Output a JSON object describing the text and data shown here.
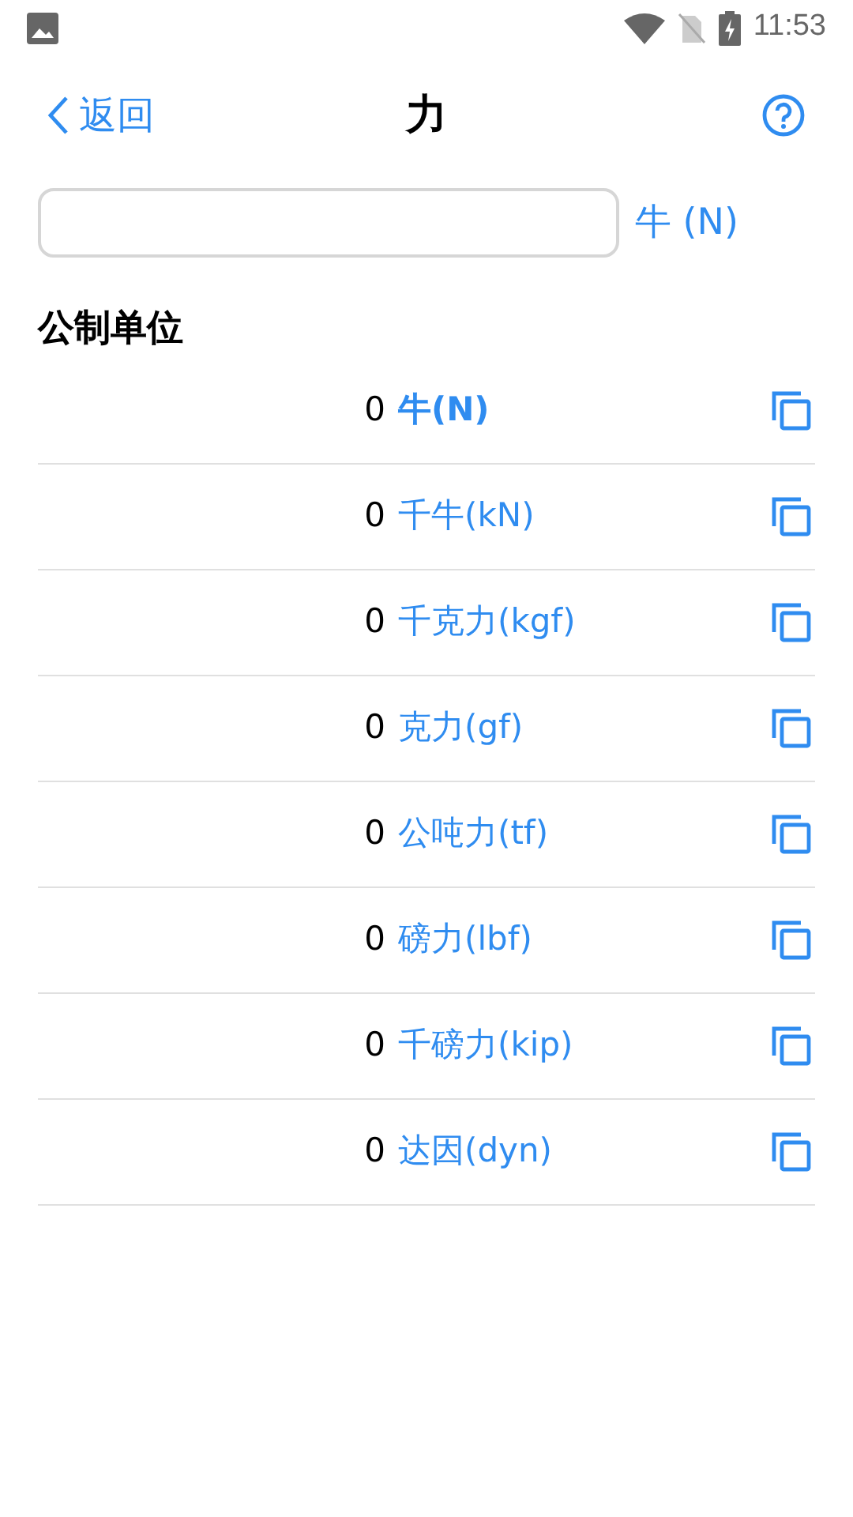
{
  "status_bar": {
    "time": "11:53"
  },
  "header": {
    "back": "返回",
    "title": "力"
  },
  "input": {
    "unit": "牛 (N)"
  },
  "section": {
    "title": "公制单位"
  },
  "units": [
    {
      "value": "0",
      "unit": "牛(N)",
      "selected": true
    },
    {
      "value": "0",
      "unit": "千牛(kN)",
      "selected": false
    },
    {
      "value": "0",
      "unit": "千克力(kgf)",
      "selected": false
    },
    {
      "value": "0",
      "unit": "克力(gf)",
      "selected": false
    },
    {
      "value": "0",
      "unit": "公吨力(tf)",
      "selected": false
    },
    {
      "value": "0",
      "unit": "磅力(lbf)",
      "selected": false
    },
    {
      "value": "0",
      "unit": "千磅力(kip)",
      "selected": false
    },
    {
      "value": "0",
      "unit": "达因(dyn)",
      "selected": false
    }
  ]
}
